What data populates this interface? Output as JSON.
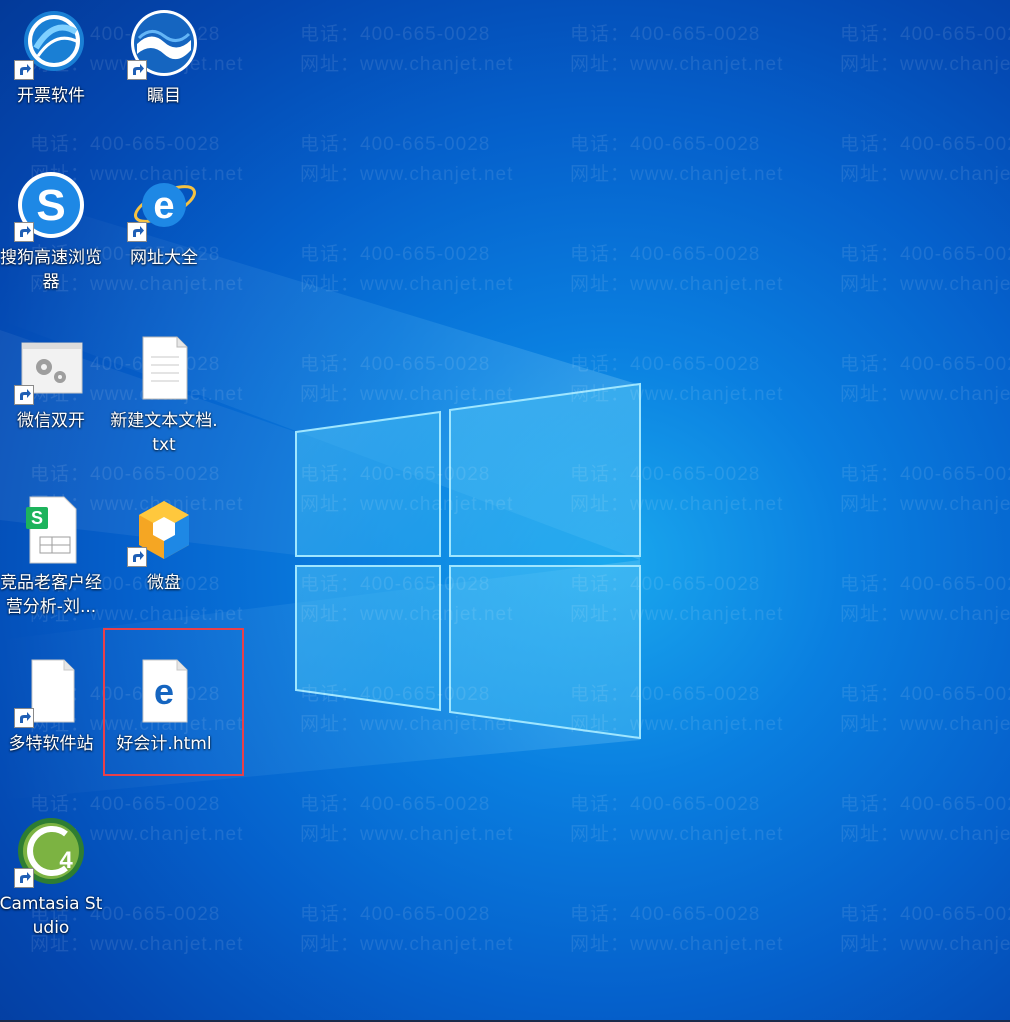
{
  "watermark": {
    "phone": "电话：400-665-0028",
    "site": "网址：www.chanjet.net"
  },
  "desktop_icons": [
    {
      "label": "开票软件",
      "icon": "invoice-software-icon"
    },
    {
      "label": "瞩目",
      "icon": "zhumu-icon"
    },
    {
      "label": "搜狗高速浏览器",
      "icon": "sogou-browser-icon"
    },
    {
      "label": "网址大全",
      "icon": "ie-browser-icon"
    },
    {
      "label": "微信双开",
      "icon": "settings-app-icon"
    },
    {
      "label": "新建文本文档.txt",
      "icon": "text-file-icon"
    },
    {
      "label": "竞品老客户经营分析-刘...",
      "icon": "spreadsheet-icon"
    },
    {
      "label": "微盘",
      "icon": "weipan-icon"
    },
    {
      "label": "多特软件站",
      "icon": "blank-file-icon"
    },
    {
      "label": "好会计.html",
      "icon": "edge-html-file-icon",
      "selected": true
    },
    {
      "label": "Camtasia Studio",
      "icon": "camtasia-icon"
    }
  ],
  "colors": {
    "selection_border": "#e8404a",
    "desktop_blue": "#0561cc"
  }
}
